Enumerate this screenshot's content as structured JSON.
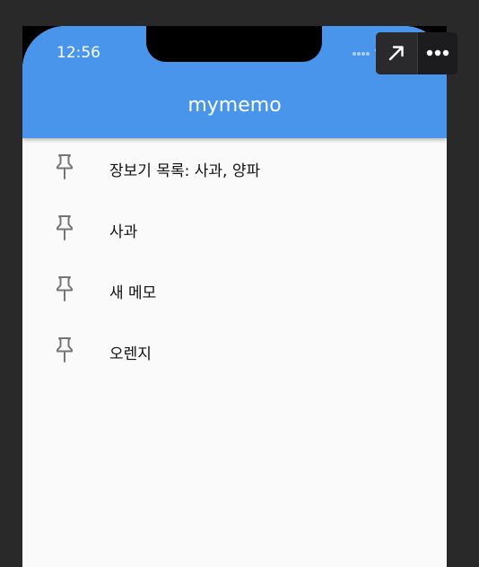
{
  "status_bar": {
    "time": "12:56",
    "icons": [
      "signal-dots-icon",
      "wifi-icon",
      "battery-icon"
    ]
  },
  "app_bar": {
    "title": "mymemo",
    "color": "#4a95ec"
  },
  "memos": [
    {
      "title": "장보기 목록: 사과, 양파",
      "icon": "pin-icon"
    },
    {
      "title": "사과",
      "icon": "pin-icon"
    },
    {
      "title": "새 메모",
      "icon": "pin-icon"
    },
    {
      "title": "오렌지",
      "icon": "pin-icon"
    }
  ],
  "overlay_toolbar": {
    "buttons": [
      "expand-icon",
      "more-icon"
    ]
  }
}
